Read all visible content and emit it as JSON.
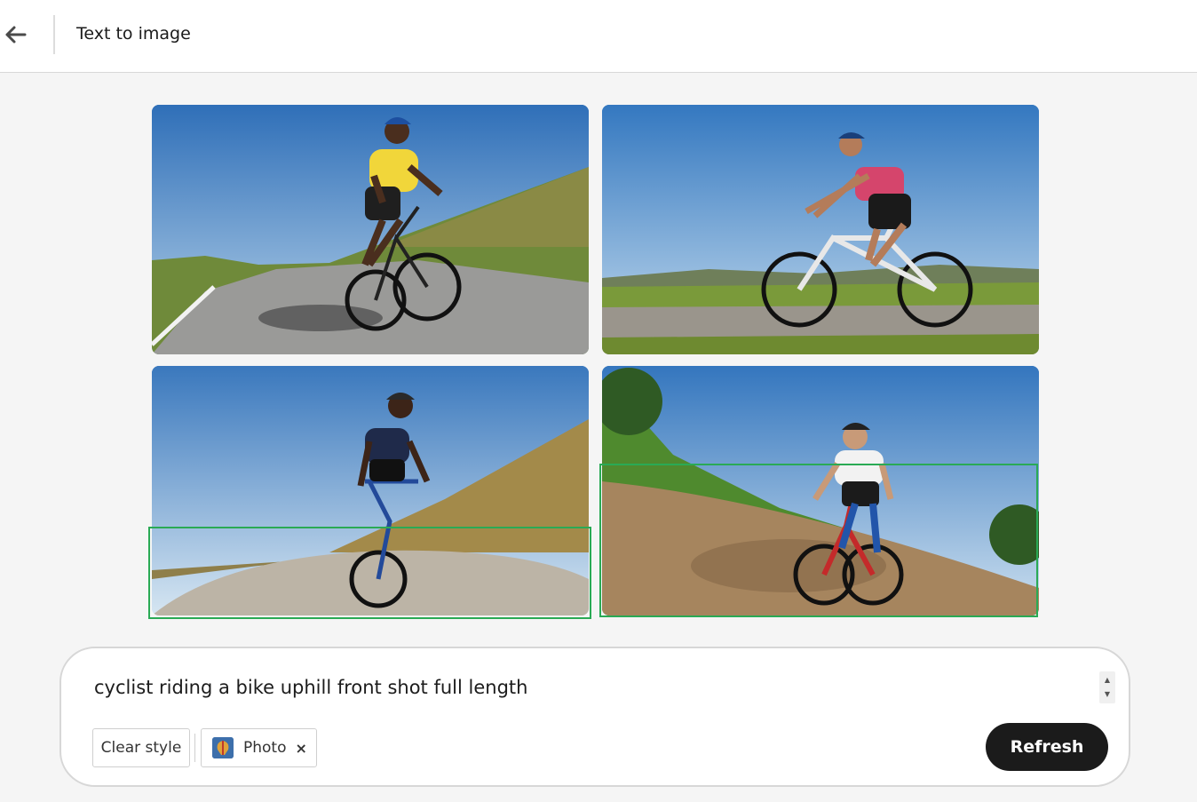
{
  "header": {
    "title": "Text to image",
    "back_icon": "arrow-left-icon"
  },
  "results": {
    "images": [
      {
        "subject": "cyclist-yellow-jersey-uphill"
      },
      {
        "subject": "cyclist-pink-top-roadside"
      },
      {
        "subject": "cyclist-navy-kit-front"
      },
      {
        "subject": "cyclist-white-red-kit-slope"
      }
    ],
    "highlight_color": "#2aaa55"
  },
  "prompt": {
    "text": "cyclist riding a bike uphill front shot full length",
    "clear_style_label": "Clear style",
    "style_chip_label": "Photo",
    "style_chip_close": "×",
    "refresh_label": "Refresh",
    "scroll_up": "▲",
    "scroll_down": "▼"
  },
  "colors": {
    "accent_button": "#1b1b1b",
    "background": "#f5f5f5"
  }
}
